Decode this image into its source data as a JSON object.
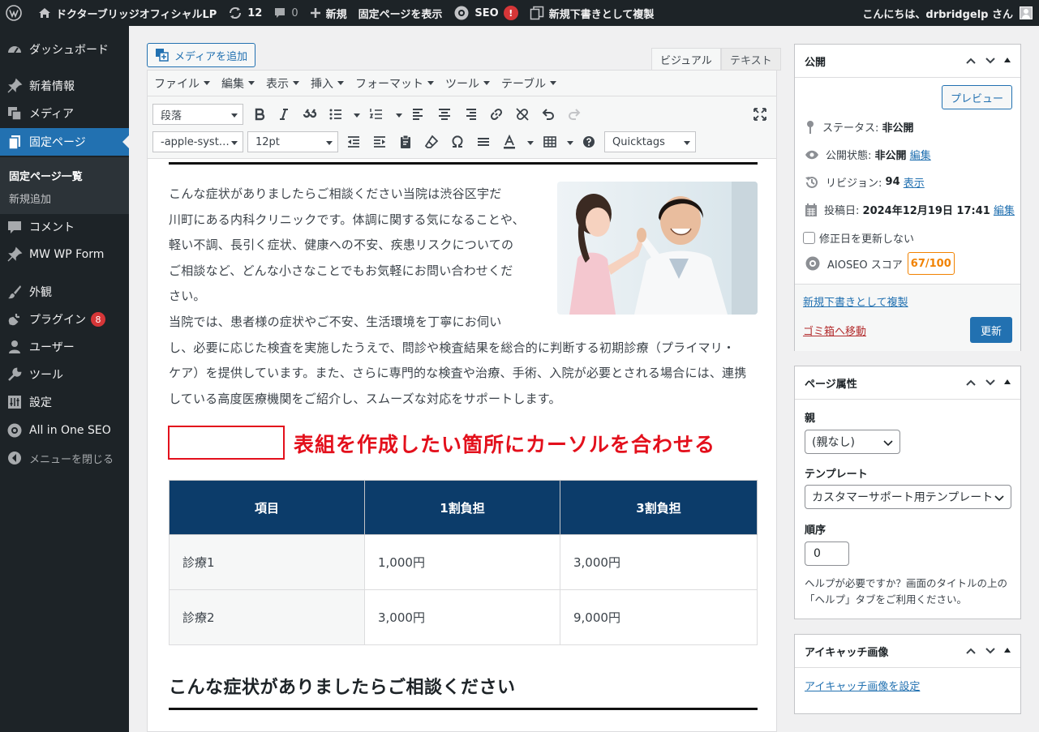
{
  "adminbar": {
    "site_name": "ドクターブリッジオフィシャルLP",
    "updates_count": "12",
    "comments_count": "0",
    "new_label": "新規",
    "view_page_label": "固定ページを表示",
    "seo_label": "SEO",
    "seo_alert": "!",
    "duplicate_label": "新規下書きとして複製",
    "greeting": "こんにちは、drbridgelp さん"
  },
  "sidebar": {
    "items": [
      {
        "label": "ダッシュボード",
        "icon": "dashboard-icon"
      },
      {
        "label": "新着情報",
        "icon": "pin-icon"
      },
      {
        "label": "メディア",
        "icon": "media-icon"
      },
      {
        "label": "固定ページ",
        "icon": "page-icon"
      },
      {
        "label": "コメント",
        "icon": "comment-icon"
      },
      {
        "label": "MW WP Form",
        "icon": "pin-icon"
      },
      {
        "label": "外観",
        "icon": "brush-icon"
      },
      {
        "label": "プラグイン",
        "icon": "plugin-icon",
        "badge": "8"
      },
      {
        "label": "ユーザー",
        "icon": "user-icon"
      },
      {
        "label": "ツール",
        "icon": "wrench-icon"
      },
      {
        "label": "設定",
        "icon": "settings-icon"
      },
      {
        "label": "All in One SEO",
        "icon": "gear-icon"
      }
    ],
    "submenu": [
      "固定ページ一覧",
      "新規追加"
    ],
    "collapse_label": "メニューを閉じる"
  },
  "editor": {
    "add_media": "メディアを追加",
    "tab_visual": "ビジュアル",
    "tab_text": "テキスト",
    "menus": [
      "ファイル",
      "編集",
      "表示",
      "挿入",
      "フォーマット",
      "ツール",
      "テーブル"
    ],
    "format_select": "段落",
    "font_select": "-apple-syst…",
    "size_select": "12pt",
    "quicktags": "Quicktags",
    "paragraph_lines": [
      "こんな症状がありましたらご相談ください当院は渋谷区宇だ",
      "川町にある内科クリニックです。体調に関する気になることや、",
      "軽い不調、長引く症状、健康への不安、疾患リスクについての",
      "ご相談など、どんな小さなことでもお気軽にお問い合わせくだ",
      "さい。",
      "当院では、患者様の症状やご不安、生活環境を丁寧にお伺い",
      "し、必要に応じた検査を実施したうえで、問診や検査結果を総合的に判断する初期診療（プライマリ・",
      "ケア）を提供しています。また、さらに専門的な検査や治療、手術、入院が必要とされる場合には、連携",
      "している高度医療機関をご紹介し、スムーズな対応をサポートします。"
    ],
    "annotation": "表組を作成したい箇所にカーソルを合わせる",
    "table": {
      "headers": [
        "項目",
        "1割負担",
        "3割負担"
      ],
      "rows": [
        [
          "診療1",
          "1,000円",
          "3,000円"
        ],
        [
          "診療2",
          "3,000円",
          "9,000円"
        ]
      ]
    },
    "heading": "こんな症状がありましたらご相談ください"
  },
  "publish": {
    "title": "公開",
    "preview": "プレビュー",
    "status_label": "ステータス:",
    "status_value": "非公開",
    "visibility_label": "公開状態:",
    "visibility_value": "非公開",
    "visibility_edit": "編集",
    "revision_label": "リビジョン:",
    "revision_value": "94",
    "revision_link": "表示",
    "date_label": "投稿日:",
    "date_value": "2024年12月19日 17:41",
    "date_edit": "編集",
    "no_update_date": "修正日を更新しない",
    "aioseo_label": "AIOSEO スコア",
    "aioseo_score": "67/100",
    "duplicate_link": "新規下書きとして複製",
    "trash_link": "ゴミ箱へ移動",
    "update_button": "更新"
  },
  "page_attributes": {
    "title": "ページ属性",
    "parent_label": "親",
    "parent_value": "(親なし)",
    "template_label": "テンプレート",
    "template_value": "カスタマーサポート用テンプレート",
    "order_label": "順序",
    "order_value": "0",
    "help_text": "ヘルプが必要ですか？画面のタイトルの上の「ヘルプ」タブをご利用ください。"
  },
  "featured_image": {
    "title": "アイキャッチ画像",
    "set_link": "アイキャッチ画像を設定"
  },
  "colors": {
    "admin_bg": "#1d2327",
    "accent": "#2271b1",
    "table_header": "#0c3c6a",
    "annotation": "#e3101c",
    "score": "#f18200"
  }
}
